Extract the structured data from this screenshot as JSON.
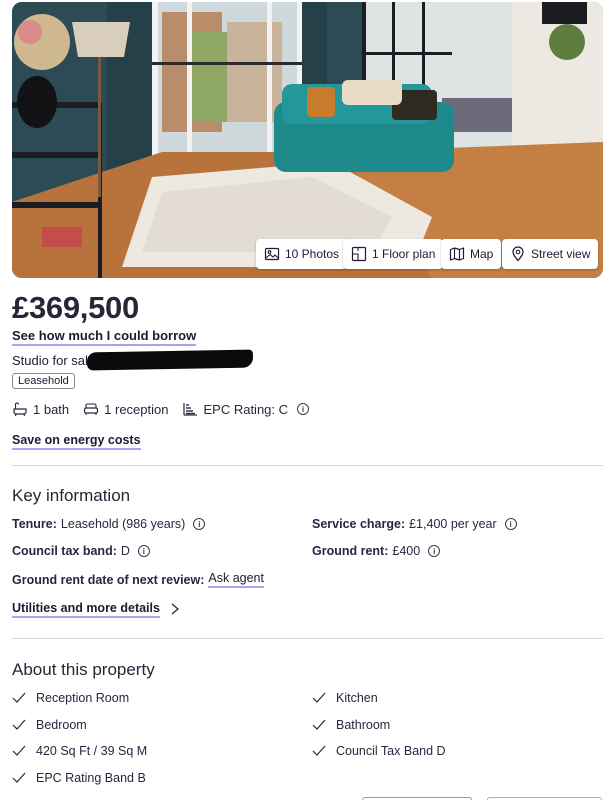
{
  "gallery": {
    "photos_label": "10 Photos",
    "floorplan_label": "1 Floor plan",
    "map_label": "Map",
    "streetview_label": "Street view"
  },
  "listing": {
    "price": "£369,500",
    "borrow_link": "See how much I could borrow",
    "subtitle": "Studio for sale",
    "tenure_badge": "Leasehold",
    "bathrooms": "1 bath",
    "receptions": "1 reception",
    "epc": "EPC Rating: C",
    "energy_link": "Save on energy costs"
  },
  "key_info": {
    "heading": "Key information",
    "tenure_label": "Tenure:",
    "tenure_value": "Leasehold (986 years)",
    "service_label": "Service charge:",
    "service_value": "£1,400 per year",
    "council_label": "Council tax band:",
    "council_value": "D",
    "ground_rent_label": "Ground rent:",
    "ground_rent_value": "£400",
    "review_label": "Ground rent date of next review:",
    "review_link": "Ask agent",
    "utilities_link": "Utilities and more details"
  },
  "about": {
    "heading": "About this property",
    "features": [
      "Reception Room",
      "Kitchen",
      "Bedroom",
      "Bathroom",
      "420 Sq Ft / 39 Sq M",
      "Council Tax Band D",
      "EPC Rating Band B"
    ]
  },
  "colors": {
    "accent_underline": "#b69cf0",
    "text": "#1f1a33"
  }
}
